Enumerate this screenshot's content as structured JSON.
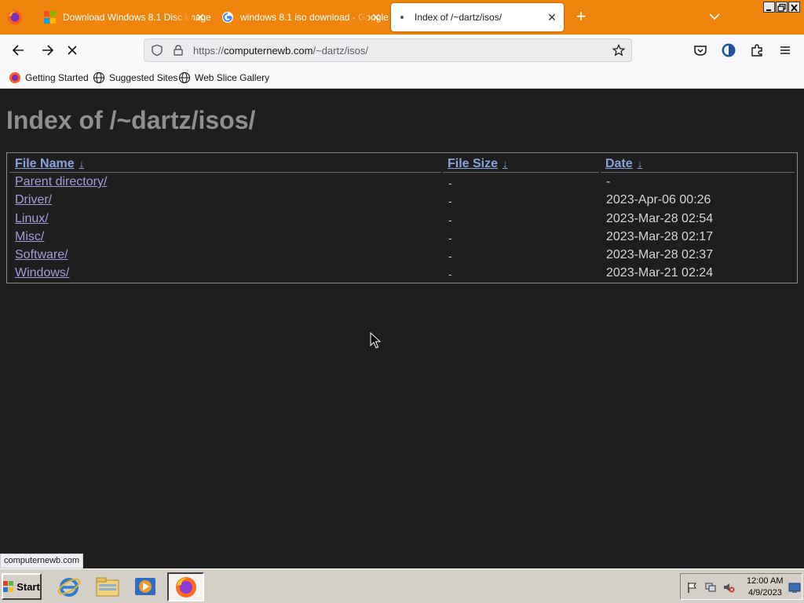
{
  "browser": {
    "tabs": [
      {
        "title": "Download Windows 8.1 Disc Image",
        "favicon": "microsoft-logo-icon",
        "active": false
      },
      {
        "title": "windows 8.1 iso download - Google",
        "favicon": "google-logo-icon",
        "active": false
      },
      {
        "title": "Index of /~dartz/isos/",
        "favicon": "loading-icon",
        "active": true
      }
    ],
    "url": {
      "scheme": "https://",
      "host": "computernewb.com",
      "path": "/~dartz/isos/"
    },
    "bookmarks": [
      {
        "label": "Getting Started",
        "icon": "firefox-icon"
      },
      {
        "label": "Suggested Sites",
        "icon": "globe-icon"
      },
      {
        "label": "Web Slice Gallery",
        "icon": "globe-icon"
      }
    ],
    "status_url": "computernewb.com"
  },
  "page": {
    "title": "Index of /~dartz/isos/",
    "columns": {
      "name": "File Name",
      "size": "File Size",
      "date": "Date",
      "sort_indicator": "↓"
    },
    "rows": [
      {
        "name": "Parent directory/",
        "size": "-",
        "date": "-"
      },
      {
        "name": "Driver/",
        "size": "-",
        "date": "2023-Apr-06 00:26"
      },
      {
        "name": "Linux/",
        "size": "-",
        "date": "2023-Mar-28 02:54"
      },
      {
        "name": "Misc/",
        "size": "-",
        "date": "2023-Mar-28 02:17"
      },
      {
        "name": "Software/",
        "size": "-",
        "date": "2023-Mar-28 02:37"
      },
      {
        "name": "Windows/",
        "size": "-",
        "date": "2023-Mar-21 02:24"
      }
    ]
  },
  "taskbar": {
    "start_label": "Start",
    "apps": [
      "internet-explorer-icon",
      "file-explorer-icon",
      "media-player-icon",
      "firefox-icon"
    ],
    "clock_time": "12:00 AM",
    "clock_date": "4/9/2023"
  },
  "colors": {
    "tab_strip": "#f0850e",
    "page_background": "#1e1e1e",
    "link": "#a59bdc",
    "header_link": "#8aa3e0"
  }
}
